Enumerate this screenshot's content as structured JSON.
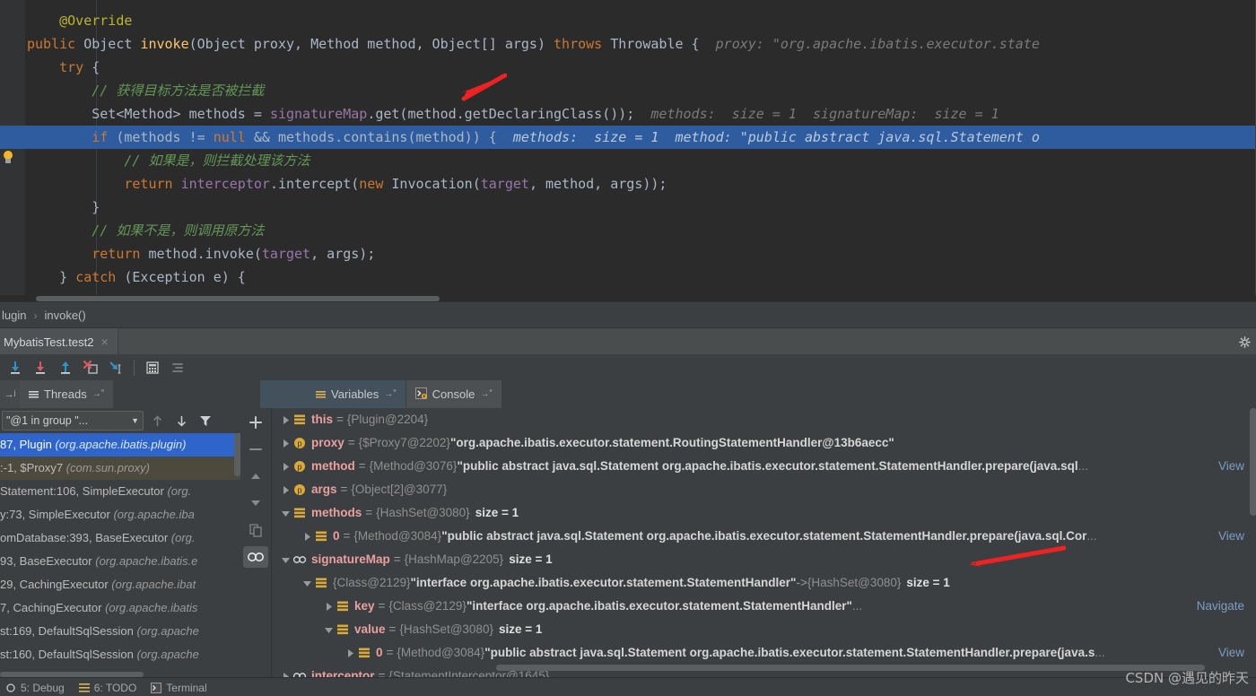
{
  "editor": {
    "language": "java",
    "lines": [
      {
        "indent": 1,
        "tokens": [
          {
            "t": "@Override",
            "c": "ann"
          }
        ]
      },
      {
        "indent": 0,
        "tokens": [
          {
            "t": "public ",
            "c": "kw"
          },
          {
            "t": "Object ",
            "c": "cls"
          },
          {
            "t": "invoke",
            "c": "mth"
          },
          {
            "t": "(Object proxy, Method method, Object[] args) ",
            "c": "def"
          },
          {
            "t": "throws ",
            "c": "kw"
          },
          {
            "t": "Throwable { ",
            "c": "def"
          },
          {
            "t": " proxy: \"org.apache.ibatis.executor.state",
            "c": "hint"
          }
        ]
      },
      {
        "indent": 1,
        "tokens": [
          {
            "t": "try ",
            "c": "kw"
          },
          {
            "t": "{",
            "c": "def"
          }
        ]
      },
      {
        "indent": 2,
        "tokens": [
          {
            "t": "// 获得目标方法是否被拦截",
            "c": "cmt"
          }
        ]
      },
      {
        "indent": 2,
        "tokens": [
          {
            "t": "Set<Method> methods = ",
            "c": "def"
          },
          {
            "t": "signatureMap",
            "c": "fld"
          },
          {
            "t": ".get(method.getDeclaringClass());",
            "c": "def"
          },
          {
            "t": "  methods:  size = 1  signatureMap:  size = 1",
            "c": "hint"
          }
        ]
      },
      {
        "indent": 2,
        "highlight": true,
        "tokens": [
          {
            "t": "if ",
            "c": "kw"
          },
          {
            "t": "(methods != ",
            "c": "def"
          },
          {
            "t": "null",
            "c": "kw"
          },
          {
            "t": " && methods.contains(method)) {",
            "c": "def"
          },
          {
            "t": "  methods:  size = 1  method: \"public abstract java.sql.Statement o",
            "c": "hint-on-hl"
          }
        ]
      },
      {
        "indent": 3,
        "tokens": [
          {
            "t": "// 如果是，则拦截处理该方法",
            "c": "cmt"
          }
        ]
      },
      {
        "indent": 3,
        "tokens": [
          {
            "t": "return ",
            "c": "kw"
          },
          {
            "t": "interceptor",
            "c": "fld"
          },
          {
            "t": ".intercept(",
            "c": "def"
          },
          {
            "t": "new ",
            "c": "kw"
          },
          {
            "t": "Invocation(",
            "c": "def"
          },
          {
            "t": "target",
            "c": "fld"
          },
          {
            "t": ", method, args));",
            "c": "def"
          }
        ]
      },
      {
        "indent": 2,
        "tokens": [
          {
            "t": "}",
            "c": "def"
          }
        ]
      },
      {
        "indent": 2,
        "tokens": [
          {
            "t": "// 如果不是，则调用原方法",
            "c": "cmt"
          }
        ]
      },
      {
        "indent": 2,
        "tokens": [
          {
            "t": "return ",
            "c": "kw"
          },
          {
            "t": "method.invoke(",
            "c": "def"
          },
          {
            "t": "target",
            "c": "fld"
          },
          {
            "t": ", args);",
            "c": "def"
          }
        ]
      },
      {
        "indent": 1,
        "tokens": [
          {
            "t": "} ",
            "c": "def"
          },
          {
            "t": "catch ",
            "c": "kw"
          },
          {
            "t": "(Exception e) {",
            "c": "def"
          }
        ]
      }
    ]
  },
  "breadcrumb": {
    "items": [
      "lugin",
      "invoke()"
    ],
    "separator": "›"
  },
  "run_tab": {
    "label": "MybatisTest.test2",
    "close_label": "×"
  },
  "debug_toolbar": {
    "buttons": [
      {
        "name": "step-over-button",
        "icon": "arrow-down-blue",
        "label": "Step Over"
      },
      {
        "name": "step-into-button",
        "icon": "arrow-down-red",
        "label": "Step Into"
      },
      {
        "name": "step-out-button",
        "icon": "arrow-up-blue",
        "label": "Step Out"
      },
      {
        "name": "force-step-into-button",
        "icon": "step-into-x",
        "label": "Force Step Into"
      },
      {
        "name": "run-to-cursor-button",
        "icon": "run-to-cursor",
        "label": "Run to Cursor"
      },
      {
        "name": "evaluate-expression-button",
        "icon": "calculator",
        "label": "Evaluate Expression"
      },
      {
        "name": "show-execution-point-button",
        "icon": "list-lines",
        "label": "Show Execution Point"
      }
    ]
  },
  "subtabs": {
    "threads": {
      "label": "Threads",
      "icon": "lines-icon",
      "pin": "→ˮ"
    },
    "variables": {
      "label": "Variables",
      "icon": "lines-icon",
      "pin": "→ˮ"
    },
    "console": {
      "label": "Console",
      "icon": "console-icon",
      "pin": "→ˮ"
    }
  },
  "frames": {
    "thread_selector_value": "\"@1 in group \"...",
    "toolbar": [
      {
        "name": "frames-up-button",
        "icon": "arrow-up"
      },
      {
        "name": "frames-down-button",
        "icon": "arrow-down"
      },
      {
        "name": "frames-filter-button",
        "icon": "funnel"
      }
    ],
    "rows": [
      {
        "text": "87, Plugin ",
        "pkg": "(org.apache.ibatis.plugin)",
        "state": "selected"
      },
      {
        "text": ":-1, $Proxy7 ",
        "pkg": "(com.sun.proxy)",
        "state": "secondary"
      },
      {
        "text": "Statement:106, SimpleExecutor ",
        "pkg": "(org.",
        "state": "normal"
      },
      {
        "text": "y:73, SimpleExecutor ",
        "pkg": "(org.apache.iba",
        "state": "normal"
      },
      {
        "text": "omDatabase:393, BaseExecutor ",
        "pkg": "(org.",
        "state": "normal"
      },
      {
        "text": "93, BaseExecutor ",
        "pkg": "(org.apache.ibatis.e",
        "state": "normal"
      },
      {
        "text": "29, CachingExecutor ",
        "pkg": "(org.apache.ibat",
        "state": "normal"
      },
      {
        "text": "7, CachingExecutor ",
        "pkg": "(org.apache.ibatis",
        "state": "normal"
      },
      {
        "text": "st:169, DefaultSqlSession ",
        "pkg": "(org.apache",
        "state": "normal"
      },
      {
        "text": "st:160, DefaultSqlSession ",
        "pkg": "(org.apache",
        "state": "normal"
      }
    ]
  },
  "side_tools": [
    {
      "name": "add-watch-button",
      "icon": "plus"
    },
    {
      "name": "remove-watch-button",
      "icon": "minus"
    },
    {
      "name": "move-watch-up-button",
      "icon": "triangle-up"
    },
    {
      "name": "move-watch-down-button",
      "icon": "triangle-down"
    },
    {
      "name": "copy-value-button",
      "icon": "copy"
    },
    {
      "name": "inspect-button",
      "icon": "glasses",
      "active": true
    }
  ],
  "variables": {
    "rows": [
      {
        "depth": 0,
        "tri": "collapsed",
        "icon": "field",
        "name": "this",
        "eq": "=",
        "type": "{Plugin@2204}",
        "value": "",
        "size": "",
        "link": ""
      },
      {
        "depth": 0,
        "tri": "collapsed",
        "icon": "param",
        "name": "proxy",
        "eq": "=",
        "type": "{$Proxy7@2202}",
        "value": "\"org.apache.ibatis.executor.statement.RoutingStatementHandler@13b6aecc\"",
        "size": "",
        "link": ""
      },
      {
        "depth": 0,
        "tri": "collapsed",
        "icon": "param",
        "name": "method",
        "eq": "=",
        "type": "{Method@3076}",
        "value": "\"public abstract java.sql.Statement org.apache.ibatis.executor.statement.StatementHandler.prepare(java.sql",
        "ellipsis": "...",
        "size": "",
        "link": "View"
      },
      {
        "depth": 0,
        "tri": "collapsed",
        "icon": "param",
        "name": "args",
        "eq": "=",
        "type": "{Object[2]@3077}",
        "value": "",
        "size": "",
        "link": ""
      },
      {
        "depth": 0,
        "tri": "expanded",
        "icon": "field",
        "name": "methods",
        "eq": "=",
        "type": "{HashSet@3080}",
        "value": "",
        "size": "size = 1",
        "link": ""
      },
      {
        "depth": 1,
        "tri": "collapsed",
        "icon": "field",
        "name": "0",
        "eq": "=",
        "type": "{Method@3084}",
        "value": "\"public abstract java.sql.Statement org.apache.ibatis.executor.statement.StatementHandler.prepare(java.sql.Cor",
        "ellipsis": "...",
        "size": "",
        "link": "View"
      },
      {
        "depth": 0,
        "tri": "expanded",
        "icon": "glasses",
        "name": "signatureMap",
        "eq": "=",
        "type": "{HashMap@2205}",
        "value": "",
        "size": "size = 1",
        "link": ""
      },
      {
        "depth": 1,
        "tri": "expanded",
        "icon": "field",
        "name": "",
        "eq": "",
        "type": "{Class@2129}",
        "value": "\"interface org.apache.ibatis.executor.statement.StatementHandler\"",
        "arrow": "->",
        "type2": "{HashSet@3080}",
        "size": "size = 1",
        "link": ""
      },
      {
        "depth": 2,
        "tri": "collapsed",
        "icon": "field",
        "name": "key",
        "eq": "=",
        "type": "{Class@2129}",
        "value": "\"interface org.apache.ibatis.executor.statement.StatementHandler\"",
        "ellipsis": "...",
        "size": "",
        "link": "Navigate"
      },
      {
        "depth": 2,
        "tri": "expanded",
        "icon": "field",
        "name": "value",
        "eq": "=",
        "type": "{HashSet@3080}",
        "value": "",
        "size": "size = 1",
        "link": ""
      },
      {
        "depth": 3,
        "tri": "collapsed",
        "icon": "field",
        "name": "0",
        "eq": "=",
        "type": "{Method@3084}",
        "value": "\"public abstract java.sql.Statement org.apache.ibatis.executor.statement.StatementHandler.prepare(java.s",
        "ellipsis": "...",
        "size": "",
        "link": "View"
      },
      {
        "depth": 0,
        "tri": "collapsed",
        "icon": "glasses",
        "name": "interceptor",
        "eq": "=",
        "type": "{StatementInterceptor@1645}",
        "value": "",
        "size": "",
        "link": ""
      }
    ]
  },
  "statusbar": {
    "items": [
      {
        "label": "5: Debug",
        "icon": "debug-icon"
      },
      {
        "label": "6: TODO",
        "icon": "todo-icon"
      },
      {
        "label": "Terminal",
        "icon": "terminal-icon"
      }
    ]
  },
  "watermark": "CSDN @遇见的昨天",
  "colors": {
    "editor_bg": "#2b2b2b",
    "panel_bg": "#3c3f41",
    "highlight_blue": "#2f5c9e",
    "selection_blue": "#2f65ca",
    "keyword_orange": "#cc7832",
    "comment_green": "#629755",
    "field_purple": "#9876aa",
    "method_yellow": "#ffc66d",
    "annotation_yellow": "#bbb529",
    "var_name_pink": "#e8a0a0",
    "link_blue": "#7a9cc6",
    "arrow_red": "#ee2222"
  }
}
